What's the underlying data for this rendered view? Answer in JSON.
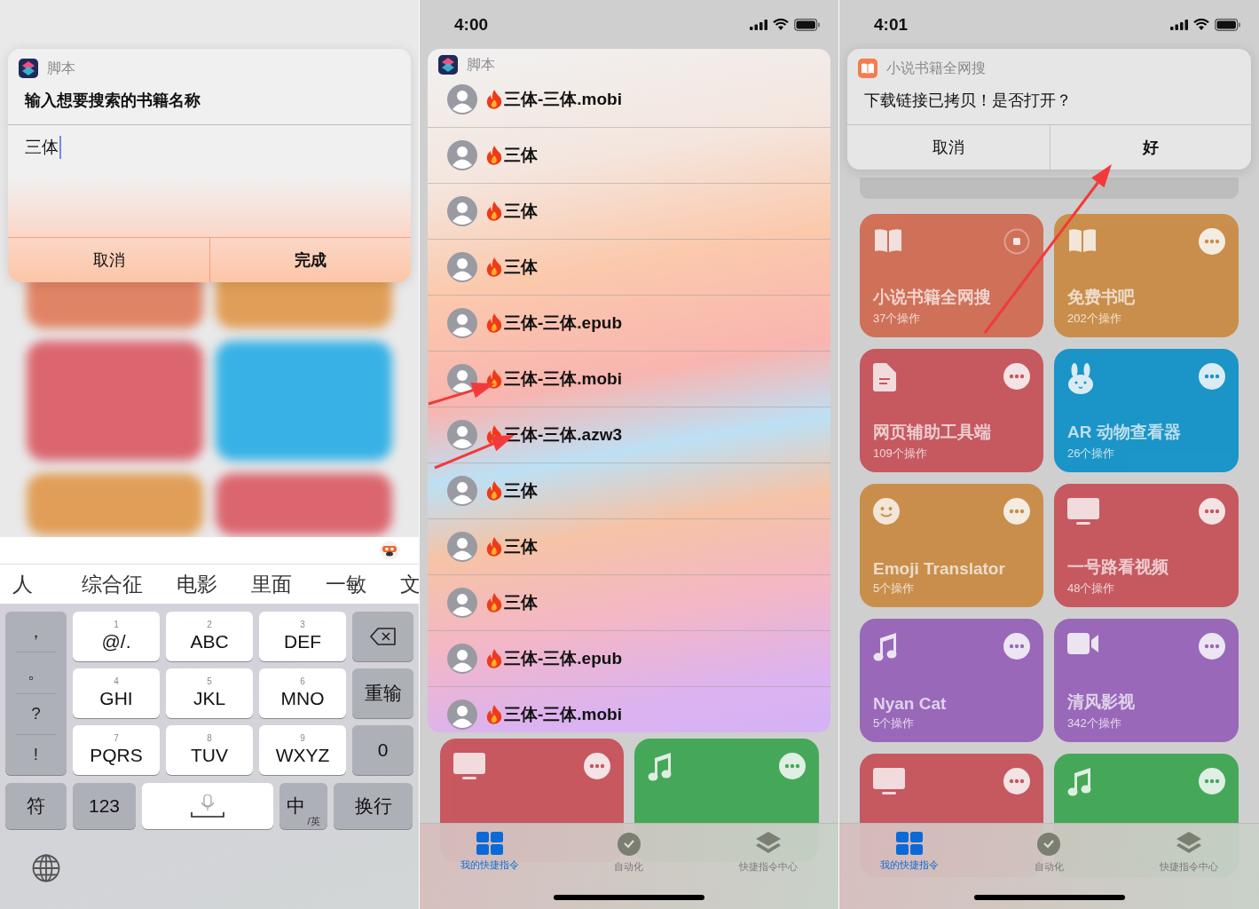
{
  "input_screen": {
    "dialog": {
      "app_name": "脚本",
      "prompt": "输入想要搜索的书籍名称",
      "value": "三体",
      "buttons": [
        {
          "label": "取消",
          "bold": false
        },
        {
          "label": "完成",
          "bold": true
        }
      ]
    },
    "keyboard": {
      "candidates": [
        "人",
        "综合征",
        "电影",
        "里面",
        "一敏",
        "文"
      ],
      "punctuation": [
        "，",
        "。",
        "?",
        "!"
      ],
      "keys": [
        {
          "digit": "1",
          "letters": "@/."
        },
        {
          "digit": "2",
          "letters": "ABC"
        },
        {
          "digit": "3",
          "letters": "DEF"
        },
        {
          "digit": "4",
          "letters": "GHI"
        },
        {
          "digit": "5",
          "letters": "JKL"
        },
        {
          "digit": "6",
          "letters": "MNO"
        },
        {
          "digit": "7",
          "letters": "PQRS"
        },
        {
          "digit": "8",
          "letters": "TUV"
        },
        {
          "digit": "9",
          "letters": "WXYZ"
        }
      ],
      "right_keys": [
        {
          "kind": "delete"
        },
        {
          "kind": "text",
          "label": "重输"
        },
        {
          "kind": "text",
          "label": "0"
        }
      ],
      "bottom_keys": [
        {
          "kind": "text",
          "label": "符"
        },
        {
          "kind": "text",
          "label": "123"
        },
        {
          "kind": "space"
        },
        {
          "kind": "lang",
          "label": "中",
          "sub": "/英"
        },
        {
          "kind": "text",
          "label": "换行"
        }
      ]
    }
  },
  "results_screen": {
    "time": "4:00",
    "app_name": "脚本",
    "results": [
      "三体-三体.mobi",
      "三体",
      "三体",
      "三体",
      "三体-三体.epub",
      "三体-三体.mobi",
      "三体-三体.azw3",
      "三体",
      "三体",
      "三体",
      "三体-三体.epub",
      "三体-三体.mobi"
    ],
    "cards": [
      {
        "kind": "tv",
        "color": "#c84f58",
        "running": false
      },
      {
        "kind": "music",
        "color": "#3ba650",
        "running": false
      }
    ],
    "tabs": [
      {
        "kind": "grid",
        "label": "我的快捷指令",
        "selected": true
      },
      {
        "kind": "clock",
        "label": "自动化",
        "selected": false
      },
      {
        "kind": "layers",
        "label": "快捷指令中心",
        "selected": false
      }
    ]
  },
  "alert_screen": {
    "time": "4:01",
    "alert": {
      "app_name": "小说书籍全网搜",
      "message": "下载链接已拷贝！是否打开？",
      "buttons": [
        {
          "label": "取消",
          "bold": false
        },
        {
          "label": "好",
          "bold": true
        }
      ]
    },
    "cards": [
      {
        "kind": "book",
        "title": "小说书籍全网搜",
        "subtitle": "37个操作",
        "color": "#d0694f",
        "running": true
      },
      {
        "kind": "book",
        "title": "免费书吧",
        "subtitle": "202个操作",
        "color": "#c98a42",
        "running": false
      },
      {
        "kind": "document",
        "title": "网页辅助工具端",
        "subtitle": "109个操作",
        "color": "#c64f58",
        "running": false
      },
      {
        "kind": "rabbit",
        "title": "AR 动物查看器",
        "subtitle": "26个操作",
        "color": "#0e90c8",
        "running": false
      },
      {
        "kind": "smiley",
        "title": "Emoji Translator",
        "subtitle": "5个操作",
        "color": "#c98a42",
        "running": false
      },
      {
        "kind": "tv",
        "title": "一号路看视频",
        "subtitle": "48个操作",
        "color": "#c64f58",
        "running": false
      },
      {
        "kind": "music",
        "title": "Nyan Cat",
        "subtitle": "5个操作",
        "color": "#9561b8",
        "running": false
      },
      {
        "kind": "video",
        "title": "清风影视",
        "subtitle": "342个操作",
        "color": "#9561b8",
        "running": false
      },
      {
        "kind": "tv",
        "color": "#c64f58",
        "running": false
      },
      {
        "kind": "music",
        "color": "#3ba650",
        "running": false
      }
    ],
    "tabs": [
      {
        "kind": "grid",
        "label": "我的快捷指令",
        "selected": true
      },
      {
        "kind": "clock",
        "label": "自动化",
        "selected": false
      },
      {
        "kind": "layers",
        "label": "快捷指令中心",
        "selected": false
      }
    ]
  }
}
